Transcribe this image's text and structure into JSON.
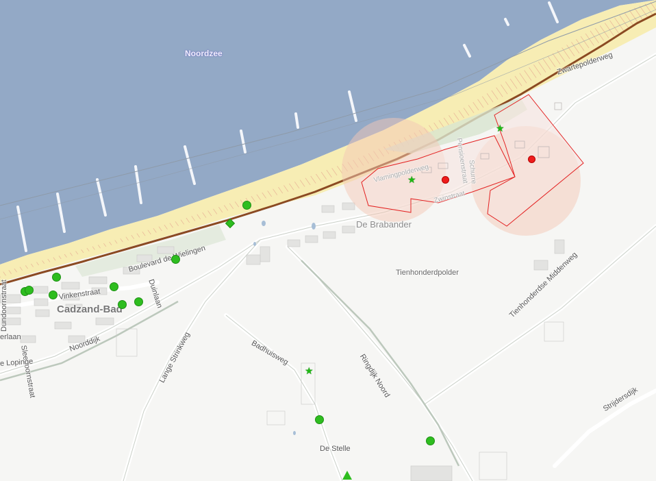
{
  "map": {
    "labels": {
      "sea": "Noordzee",
      "town": "Cadzand-Bad",
      "district": "De Brabander",
      "polder": "Tienhonderdpolder",
      "village": "De Stelle",
      "boulevard": "Boulevard de Wielingen",
      "duinlaan": "Duinlaan",
      "vinkenstraat": "Vinkenstraat",
      "dundoornstraat": "Dundoornstraat",
      "sleedoornstraat": "Sleedoornstraat",
      "noorddijk": "Noorddijk",
      "lopinge": "e Lopinge",
      "erlaan": "erlaan",
      "lange_strinkweg": "Lange Strinkweg",
      "badhuisweg": "Badhuisweg",
      "ringdijk_noord": "Ringdijk Noord",
      "tienhonderdse_middenweg": "Tienhonderdse Middenweg",
      "zwartepolderweg": "Zwartepolderweg",
      "strijdersdijk": "Strijdersdijk",
      "faint_road_1": "Vlamingpolderweg",
      "faint_road_2": "Pensioenstraat",
      "faint_road_3": "Schurre",
      "faint_road_4": "Zwinstraat"
    },
    "colors": {
      "sea": "#93a9c6",
      "beach": "#f7edb4",
      "land": "#f6f6f4",
      "dike": "#8b4a22",
      "zone_fill": "#f4c8b6",
      "zone_outline": "#e32020",
      "poi_green": "#2ebd1f",
      "poi_red": "#ee1c1c"
    },
    "markers": [
      {
        "type": "dot-green",
        "icon": "green-dot-icon"
      },
      {
        "type": "dot-green",
        "icon": "green-dot-icon"
      },
      {
        "type": "dot-green",
        "icon": "green-dot-icon"
      },
      {
        "type": "dot-green",
        "icon": "green-dot-icon"
      },
      {
        "type": "dot-green",
        "icon": "green-dot-icon"
      },
      {
        "type": "dot-green",
        "icon": "green-dot-icon"
      },
      {
        "type": "dot-green",
        "icon": "green-dot-icon"
      },
      {
        "type": "dot-green",
        "icon": "green-dot-icon"
      },
      {
        "type": "dot-green",
        "icon": "green-dot-icon"
      },
      {
        "type": "dot-green",
        "icon": "green-dot-icon"
      },
      {
        "type": "dot-green",
        "icon": "green-dot-icon"
      },
      {
        "type": "dot-green",
        "icon": "green-dot-icon"
      },
      {
        "type": "diamond",
        "icon": "green-diamond-icon"
      },
      {
        "type": "star",
        "icon": "green-star-icon"
      },
      {
        "type": "star",
        "icon": "green-star-icon"
      },
      {
        "type": "star",
        "icon": "green-star-icon"
      },
      {
        "type": "dot-red",
        "icon": "red-dot-icon"
      },
      {
        "type": "dot-red",
        "icon": "red-dot-icon"
      },
      {
        "type": "tri",
        "icon": "green-triangle-icon"
      }
    ]
  }
}
